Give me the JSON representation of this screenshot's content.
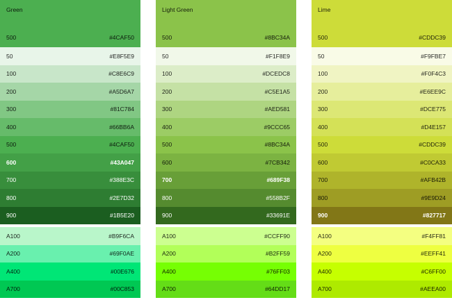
{
  "palettes": [
    {
      "name": "Green",
      "header": {
        "shade": "500",
        "hex": "#4CAF50",
        "color": "#4CAF50",
        "text": "dark"
      },
      "shades": [
        {
          "shade": "50",
          "hex": "#E8F5E9",
          "color": "#E8F5E9",
          "text": "dark"
        },
        {
          "shade": "100",
          "hex": "#C8E6C9",
          "color": "#C8E6C9",
          "text": "dark"
        },
        {
          "shade": "200",
          "hex": "#A5D6A7",
          "color": "#A5D6A7",
          "text": "dark"
        },
        {
          "shade": "300",
          "hex": "#81C784",
          "color": "#81C784",
          "text": "dark"
        },
        {
          "shade": "400",
          "hex": "#66BB6A",
          "color": "#66BB6A",
          "text": "dark"
        },
        {
          "shade": "500",
          "hex": "#4CAF50",
          "color": "#4CAF50",
          "text": "dark"
        },
        {
          "shade": "600",
          "hex": "#43A047",
          "color": "#43A047",
          "text": "light-bold"
        },
        {
          "shade": "700",
          "hex": "#388E3C",
          "color": "#388E3C",
          "text": "light"
        },
        {
          "shade": "800",
          "hex": "#2E7D32",
          "color": "#2E7D32",
          "text": "light"
        },
        {
          "shade": "900",
          "hex": "#1B5E20",
          "color": "#1B5E20",
          "text": "light"
        }
      ],
      "accents": [
        {
          "shade": "A100",
          "hex": "#B9F6CA",
          "color": "#B9F6CA",
          "text": "dark"
        },
        {
          "shade": "A200",
          "hex": "#69F0AE",
          "color": "#69F0AE",
          "text": "dark"
        },
        {
          "shade": "A400",
          "hex": "#00E676",
          "color": "#00E676",
          "text": "dark"
        },
        {
          "shade": "A700",
          "hex": "#00C853",
          "color": "#00C853",
          "text": "dark"
        }
      ]
    },
    {
      "name": "Light Green",
      "header": {
        "shade": "500",
        "hex": "#8BC34A",
        "color": "#8BC34A",
        "text": "dark"
      },
      "shades": [
        {
          "shade": "50",
          "hex": "#F1F8E9",
          "color": "#F1F8E9",
          "text": "dark"
        },
        {
          "shade": "100",
          "hex": "#DCEDC8",
          "color": "#DCEDC8",
          "text": "dark"
        },
        {
          "shade": "200",
          "hex": "#C5E1A5",
          "color": "#C5E1A5",
          "text": "dark"
        },
        {
          "shade": "300",
          "hex": "#AED581",
          "color": "#AED581",
          "text": "dark"
        },
        {
          "shade": "400",
          "hex": "#9CCC65",
          "color": "#9CCC65",
          "text": "dark"
        },
        {
          "shade": "500",
          "hex": "#8BC34A",
          "color": "#8BC34A",
          "text": "dark"
        },
        {
          "shade": "600",
          "hex": "#7CB342",
          "color": "#7CB342",
          "text": "dark"
        },
        {
          "shade": "700",
          "hex": "#689F38",
          "color": "#689F38",
          "text": "light-bold"
        },
        {
          "shade": "800",
          "hex": "#558B2F",
          "color": "#558B2F",
          "text": "light"
        },
        {
          "shade": "900",
          "hex": "#33691E",
          "color": "#33691E",
          "text": "light"
        }
      ],
      "accents": [
        {
          "shade": "A100",
          "hex": "#CCFF90",
          "color": "#CCFF90",
          "text": "dark"
        },
        {
          "shade": "A200",
          "hex": "#B2FF59",
          "color": "#B2FF59",
          "text": "dark"
        },
        {
          "shade": "A400",
          "hex": "#76FF03",
          "color": "#76FF03",
          "text": "dark"
        },
        {
          "shade": "A700",
          "hex": "#64DD17",
          "color": "#64DD17",
          "text": "dark"
        }
      ]
    },
    {
      "name": "Lime",
      "header": {
        "shade": "500",
        "hex": "#CDDC39",
        "color": "#CDDC39",
        "text": "dark"
      },
      "shades": [
        {
          "shade": "50",
          "hex": "#F9FBE7",
          "color": "#F9FBE7",
          "text": "dark"
        },
        {
          "shade": "100",
          "hex": "#F0F4C3",
          "color": "#F0F4C3",
          "text": "dark"
        },
        {
          "shade": "200",
          "hex": "#E6EE9C",
          "color": "#E6EE9C",
          "text": "dark"
        },
        {
          "shade": "300",
          "hex": "#DCE775",
          "color": "#DCE775",
          "text": "dark"
        },
        {
          "shade": "400",
          "hex": "#D4E157",
          "color": "#D4E157",
          "text": "dark"
        },
        {
          "shade": "500",
          "hex": "#CDDC39",
          "color": "#CDDC39",
          "text": "dark"
        },
        {
          "shade": "600",
          "hex": "#C0CA33",
          "color": "#C0CA33",
          "text": "dark"
        },
        {
          "shade": "700",
          "hex": "#AFB42B",
          "color": "#AFB42B",
          "text": "dark"
        },
        {
          "shade": "800",
          "hex": "#9E9D24",
          "color": "#9E9D24",
          "text": "dark"
        },
        {
          "shade": "900",
          "hex": "#827717",
          "color": "#827717",
          "text": "light-bold"
        }
      ],
      "accents": [
        {
          "shade": "A100",
          "hex": "#F4FF81",
          "color": "#F4FF81",
          "text": "dark"
        },
        {
          "shade": "A200",
          "hex": "#EEFF41",
          "color": "#EEFF41",
          "text": "dark"
        },
        {
          "shade": "A400",
          "hex": "#C6FF00",
          "color": "#C6FF00",
          "text": "dark"
        },
        {
          "shade": "A700",
          "hex": "#AEEA00",
          "color": "#AEEA00",
          "text": "dark"
        }
      ]
    }
  ]
}
